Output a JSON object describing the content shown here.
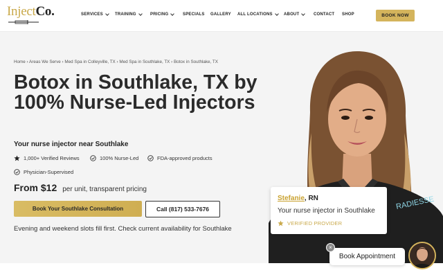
{
  "brand": {
    "logo_main": "Inject",
    "logo_accent": "Co.",
    "accent_color": "#d4b45c"
  },
  "nav": {
    "items": [
      {
        "label": "SERVICES",
        "dropdown": true
      },
      {
        "label": "TRAINING",
        "dropdown": true
      },
      {
        "label": "PRICING",
        "dropdown": true
      },
      {
        "label": "SPECIALS",
        "dropdown": false
      },
      {
        "label": "GALLERY",
        "dropdown": false
      },
      {
        "label": "ALL LOCATIONS",
        "dropdown": true
      },
      {
        "label": "ABOUT",
        "dropdown": true
      },
      {
        "label": "CONTACT",
        "dropdown": false
      },
      {
        "label": "SHOP",
        "dropdown": false
      }
    ],
    "book_now": "BOOK NOW"
  },
  "breadcrumb": "Home › Areas We Serve › Med Spa in Colleyville, TX › Med Spa in Southlake, TX › Botox in Southlake, TX",
  "hero": {
    "title": "Botox in Southlake, TX by 100% Nurse-Led Injectors",
    "subtitle": "Your nurse injector near Southlake",
    "badges": {
      "reviews": "1,000+ Verified Reviews",
      "nurse_led": "100% Nurse-Led",
      "fda": "FDA-approved products",
      "physician": "Physician-Supervised"
    },
    "price_main": "From $12",
    "price_sub": "per unit, transparent pricing",
    "cta_primary": "Book Your Southlake Consultation",
    "cta_secondary": "Call (817) 533-7676",
    "note": "Evening and weekend slots fill first. Check current availability for Southlake"
  },
  "provider": {
    "name": "Stefanie",
    "credential": ", RN",
    "role": "Your nurse injector in Southlake",
    "verified": "VERIFIED PROVIDER",
    "shirt_text": "RADIESSE"
  },
  "chat": {
    "label": "Book Appointment",
    "close": "×"
  }
}
